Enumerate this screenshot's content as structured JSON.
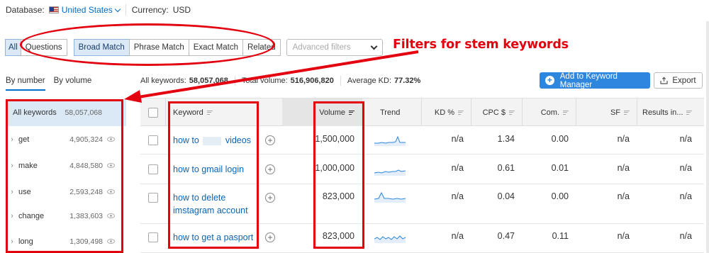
{
  "topbar": {
    "database_label": "Database:",
    "database_value": "United States",
    "currency_label": "Currency:",
    "currency_value": "USD"
  },
  "filters": {
    "all": "All",
    "questions": "Questions",
    "broad_match": "Broad Match",
    "phrase_match": "Phrase Match",
    "exact_match": "Exact Match",
    "related": "Related",
    "advanced_placeholder": "Advanced filters"
  },
  "annotation": {
    "text": "Filters for stem keywords",
    "color": "#e3000f"
  },
  "views": {
    "by_number": "By number",
    "by_volume": "By volume"
  },
  "summary": {
    "all_keywords_label": "All keywords:",
    "all_keywords_value": "58,057,068",
    "total_volume_label": "Total volume:",
    "total_volume_value": "516,906,820",
    "avg_kd_label": "Average KD:",
    "avg_kd_value": "77.32%"
  },
  "actions": {
    "add_to_manager": "Add to Keyword Manager",
    "export": "Export"
  },
  "sidebar": {
    "all_label": "All keywords",
    "all_count": "58,057,068",
    "items": [
      {
        "label": "get",
        "count": "4,905,324"
      },
      {
        "label": "make",
        "count": "4,848,580"
      },
      {
        "label": "use",
        "count": "2,593,248"
      },
      {
        "label": "change",
        "count": "1,383,603"
      },
      {
        "label": "long",
        "count": "1,309,498"
      }
    ]
  },
  "table": {
    "headers": {
      "keyword": "Keyword",
      "volume": "Volume",
      "trend": "Trend",
      "kd": "KD %",
      "cpc": "CPC $",
      "com": "Com.",
      "sf": "SF",
      "results": "Results in..."
    },
    "rows": [
      {
        "kw_a": "how to",
        "kw_b": "videos",
        "volume": "1,500,000",
        "kd": "n/a",
        "cpc": "1.34",
        "com": "0.00",
        "sf": "n/a",
        "results": "n/a"
      },
      {
        "kw": "how to gmail login",
        "volume": "1,000,000",
        "kd": "n/a",
        "cpc": "0.61",
        "com": "0.01",
        "sf": "n/a",
        "results": "n/a"
      },
      {
        "kw_l1": "how to delete",
        "kw_l2": "imstagram account",
        "volume": "823,000",
        "kd": "n/a",
        "cpc": "0.04",
        "com": "0.00",
        "sf": "n/a",
        "results": "n/a"
      },
      {
        "kw": "how to get a pasport",
        "volume": "823,000",
        "kd": "n/a",
        "cpc": "0.47",
        "com": "0.11",
        "sf": "n/a",
        "results": "n/a"
      }
    ]
  },
  "colors": {
    "accent": "#006dca",
    "button": "#2e86de",
    "active_filter_bg": "#dbe9f7",
    "annotation": "#e3000f",
    "link": "#0b64b8"
  }
}
